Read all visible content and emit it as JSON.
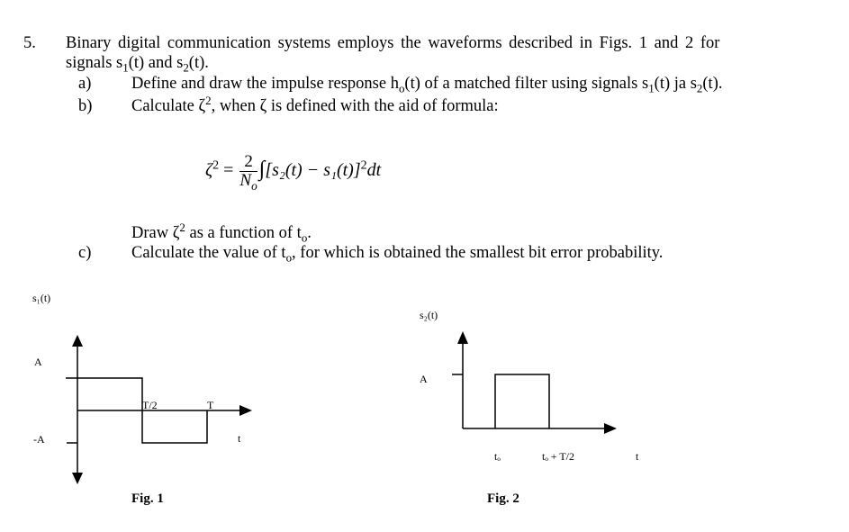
{
  "problem": {
    "number": "5.",
    "intro_line1": "Binary digital communication systems employs the waveforms described in Figs. 1 and 2 for",
    "intro_line2_prefix": "signals s",
    "intro_line2_sub1": "1",
    "intro_line2_mid": "(t) and s",
    "intro_line2_sub2": "2",
    "intro_line2_suffix": "(t).",
    "parts": [
      {
        "label": "a)",
        "text_prefix": "Define and draw the impulse response h",
        "text_sub_o": "o",
        "text_mid1": "(t) of a matched filter using signals s",
        "text_sub1": "1",
        "text_mid2": "(t) ja s",
        "text_sub2": "2",
        "text_suffix": "(t)."
      },
      {
        "label": "b)",
        "text_prefix": "Calculate ",
        "zeta": "ζ",
        "sup2": "2",
        "text_mid": ", when ",
        "text_suffix": " is defined with the aid of formula:"
      },
      {
        "label": "c)",
        "text": "Calculate the value of  t",
        "text_sub_o": "o",
        "text_suffix": ", for which is obtained the smallest bit error probability."
      }
    ],
    "draw_line": {
      "prefix": "Draw ",
      "zeta": "ζ",
      "sup2": "2",
      "mid": " as a function of  t",
      "sub_o": "o",
      "suffix": "."
    },
    "formula": {
      "lhs": "ζ",
      "lhs_sup": "2",
      "equals": "=",
      "numerator": "2",
      "denominator": "N",
      "denominator_sub": "o",
      "integral": "∫",
      "body": "[s₂(t) − s₁(t)]",
      "body_sup": "2",
      "dt": "dt"
    }
  },
  "figures": [
    {
      "caption": "Fig. 1",
      "ylabel": "s₁(t)",
      "label_A": "A",
      "label_negA": "-A",
      "tick_half": "T/2",
      "tick_T": "T",
      "xlabel": "t",
      "signal": {
        "description": "rectangular: +A on [0, T/2], -A on [T/2, T]",
        "segments": [
          {
            "from": "0",
            "to": "T/2",
            "level": "A"
          },
          {
            "from": "T/2",
            "to": "T",
            "level": "-A"
          }
        ]
      }
    },
    {
      "caption": "Fig. 2",
      "ylabel": "s₂(t)",
      "label_A": "A",
      "tick_to": "tₒ",
      "tick_to_half": "tₒ + T/2",
      "xlabel": "t",
      "signal": {
        "description": "rectangular pulse of amplitude A on [to, to + T/2]",
        "segments": [
          {
            "from": "to",
            "to": "to + T/2",
            "level": "A"
          }
        ]
      }
    }
  ]
}
